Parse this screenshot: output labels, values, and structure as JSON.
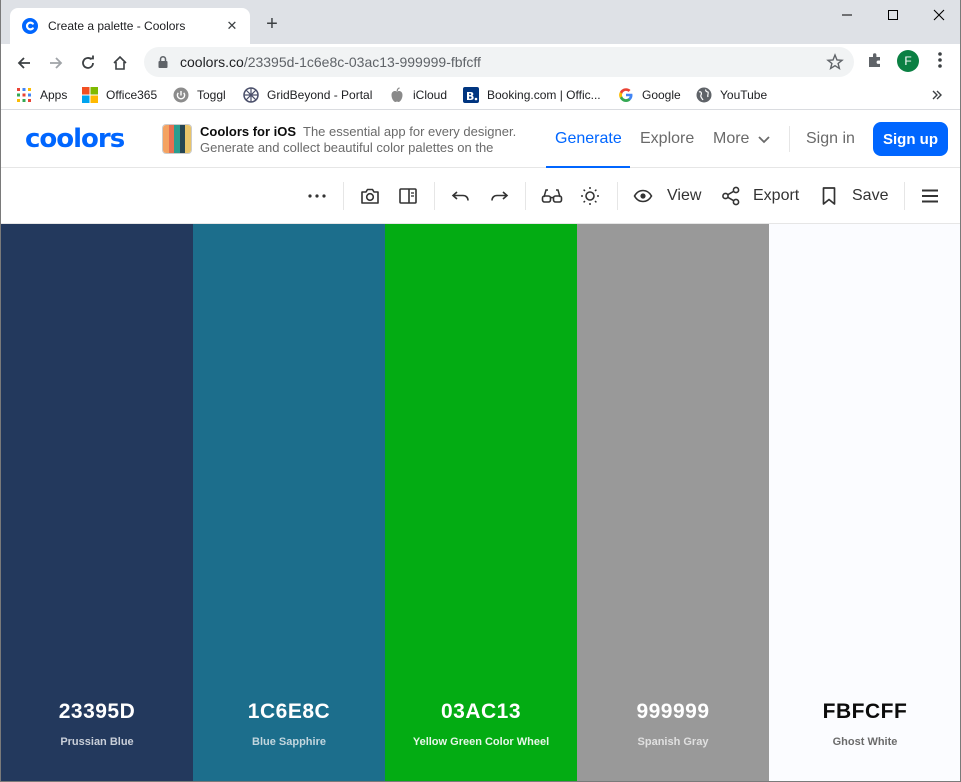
{
  "browser": {
    "tab": {
      "title": "Create a palette - Coolors",
      "favicon": "coolors-icon"
    },
    "address": {
      "host": "coolors.co",
      "path": "/23395d-1c6e8c-03ac13-999999-fbfcff"
    },
    "profile_initial": "F",
    "bookmarks": [
      {
        "label": "Apps",
        "icon": "apps-grid-icon"
      },
      {
        "label": "Office365",
        "icon": "office365-icon"
      },
      {
        "label": "Toggl",
        "icon": "toggl-icon"
      },
      {
        "label": "GridBeyond - Portal",
        "icon": "gridbeyond-icon"
      },
      {
        "label": "iCloud",
        "icon": "apple-icon"
      },
      {
        "label": "Booking.com | Offic...",
        "icon": "booking-icon"
      },
      {
        "label": "Google",
        "icon": "google-icon"
      },
      {
        "label": "YouTube",
        "icon": "globe-icon"
      }
    ]
  },
  "header": {
    "logo": "coolors",
    "promo": {
      "title": "Coolors for iOS",
      "line1": "The essential app for every designer.",
      "line2": "Generate and collect beautiful color palettes on the"
    },
    "nav": {
      "generate": "Generate",
      "explore": "Explore",
      "more": "More"
    },
    "sign_in": "Sign in",
    "sign_up": "Sign up",
    "accent": "#0066ff"
  },
  "toolbar": {
    "view_label": "View",
    "export_label": "Export",
    "save_label": "Save"
  },
  "palette": [
    {
      "hex": "23395D",
      "name": "Prussian Blue",
      "color": "#23395d",
      "text_color": "#ffffff",
      "name_color": "#c9cfd9"
    },
    {
      "hex": "1C6E8C",
      "name": "Blue Sapphire",
      "color": "#1c6e8c",
      "text_color": "#ffffff",
      "name_color": "#c2d6de"
    },
    {
      "hex": "03AC13",
      "name": "Yellow Green Color Wheel",
      "color": "#03ac13",
      "text_color": "#ffffff",
      "name_color": "#e8f6e9"
    },
    {
      "hex": "999999",
      "name": "Spanish Gray",
      "color": "#999999",
      "text_color": "#ffffff",
      "name_color": "#e0e0e0"
    },
    {
      "hex": "FBFCFF",
      "name": "Ghost White",
      "color": "#fbfcff",
      "text_color": "#0b0b0b",
      "name_color": "#6b6b6b"
    }
  ]
}
